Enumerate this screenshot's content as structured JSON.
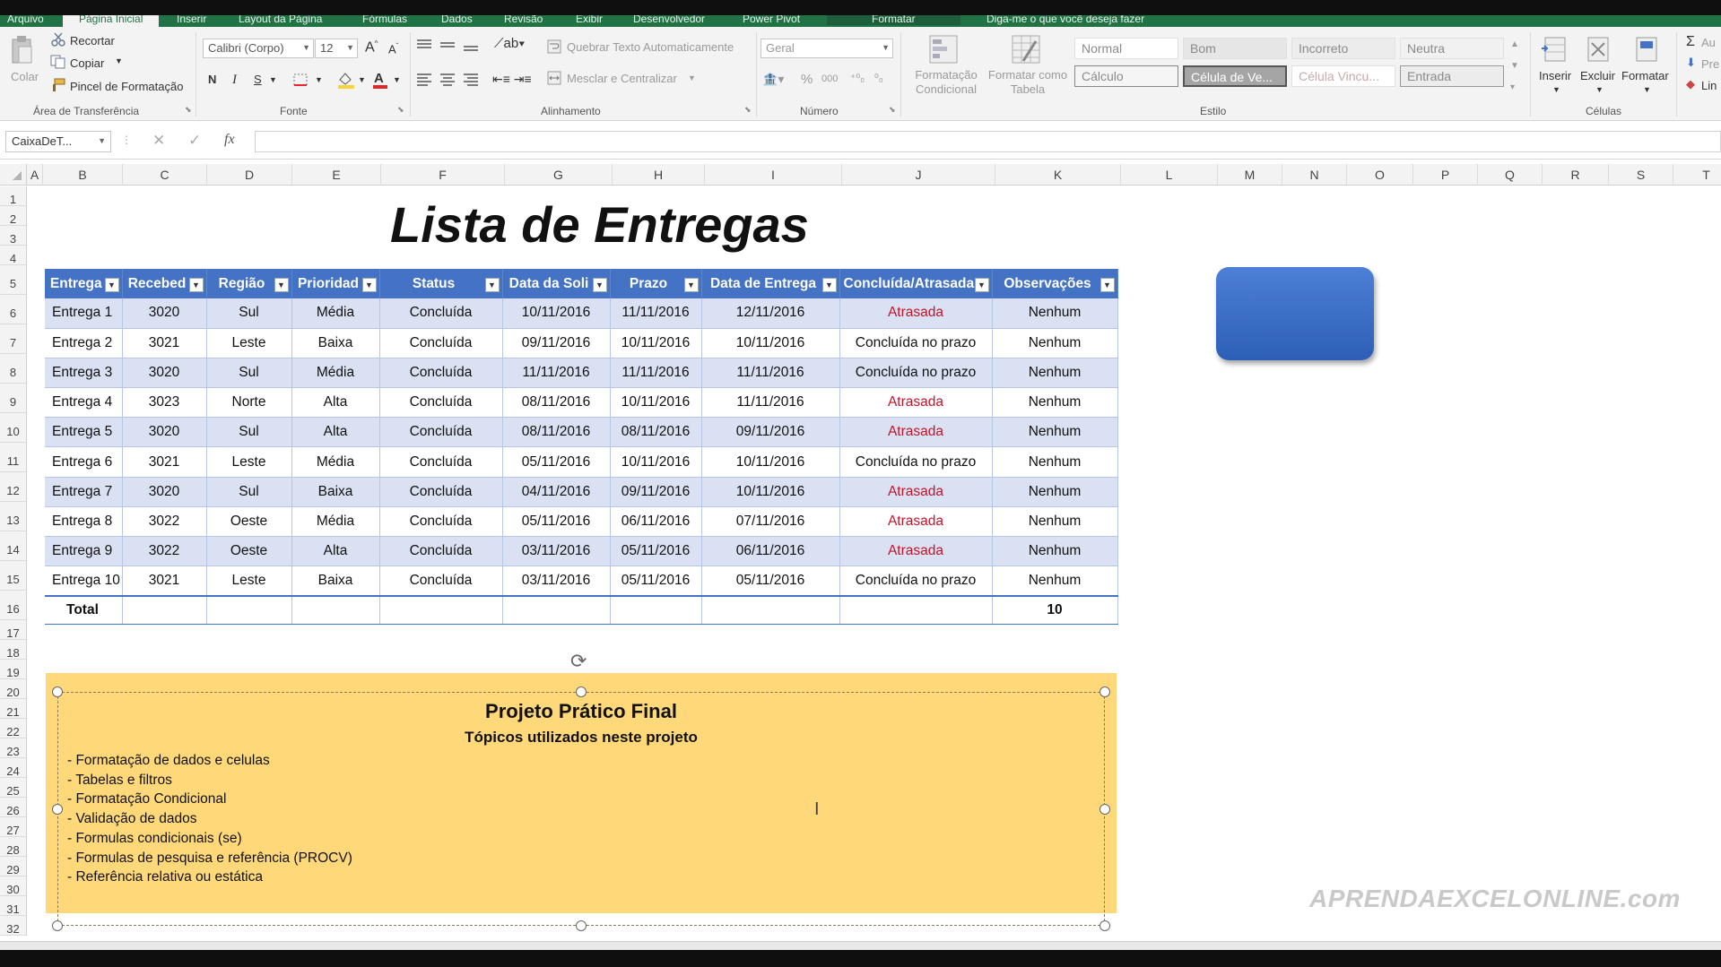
{
  "ribbon_tabs": [
    "Arquivo",
    "Página Inicial",
    "Inserir",
    "Layout da Página",
    "Fórmulas",
    "Dados",
    "Revisão",
    "Exibir",
    "Desenvolvedor",
    "Power Pivot",
    "Formatar",
    "Diga-me o que você deseja fazer"
  ],
  "clipboard": {
    "paste": "Colar",
    "cut": "Recortar",
    "copy": "Copiar",
    "format_painter": "Pincel de Formatação",
    "label": "Área de Transferência"
  },
  "font": {
    "name": "Calibri (Corpo)",
    "size": "12",
    "bold": "N",
    "italic": "I",
    "underline": "S",
    "label": "Fonte"
  },
  "alignment": {
    "wrap": "Quebrar Texto Automaticamente",
    "merge": "Mesclar e Centralizar",
    "label": "Alinhamento"
  },
  "number": {
    "format": "Geral",
    "label": "Número"
  },
  "styles": {
    "conditional": "Formatação Condicional",
    "as_table": "Formatar como Tabela",
    "cells": [
      "Normal",
      "Bom",
      "Incorreto",
      "Neutra",
      "Cálculo",
      "Célula de Ve...",
      "Célula Vincu...",
      "Entrada"
    ],
    "label": "Estilo"
  },
  "cells_group": {
    "insert": "Inserir",
    "delete": "Excluir",
    "format": "Formatar",
    "label": "Células",
    "extra1": "Au",
    "extra2": "Pre",
    "extra3": "Lin"
  },
  "namebox": "CaixaDeT...",
  "fx": "fx",
  "columns": [
    "A",
    "B",
    "C",
    "D",
    "E",
    "F",
    "G",
    "H",
    "I",
    "J",
    "K",
    "L",
    "M",
    "N",
    "O",
    "P",
    "Q",
    "R",
    "S",
    "T"
  ],
  "rows": [
    "1",
    "2",
    "3",
    "4",
    "5",
    "6",
    "7",
    "8",
    "9",
    "10",
    "11",
    "12",
    "13",
    "14",
    "15",
    "16",
    "17",
    "18",
    "19",
    "20",
    "21",
    "22",
    "23",
    "24",
    "25",
    "26",
    "27",
    "28",
    "29",
    "30",
    "31",
    "32"
  ],
  "sheet_title": "Lista de Entregas",
  "table": {
    "headers": [
      "Entrega",
      "Recebed",
      "Região",
      "Prioridad",
      "Status",
      "Data da Soli",
      "Prazo",
      "Data de Entrega",
      "Concluída/Atrasada",
      "Observações"
    ],
    "rows": [
      [
        "Entrega 1",
        "3020",
        "Sul",
        "Média",
        "Concluída",
        "10/11/2016",
        "11/11/2016",
        "12/11/2016",
        "Atrasada",
        "Nenhum"
      ],
      [
        "Entrega 2",
        "3021",
        "Leste",
        "Baixa",
        "Concluída",
        "09/11/2016",
        "10/11/2016",
        "10/11/2016",
        "Concluída no prazo",
        "Nenhum"
      ],
      [
        "Entrega 3",
        "3020",
        "Sul",
        "Média",
        "Concluída",
        "11/11/2016",
        "11/11/2016",
        "11/11/2016",
        "Concluída no prazo",
        "Nenhum"
      ],
      [
        "Entrega 4",
        "3023",
        "Norte",
        "Alta",
        "Concluída",
        "08/11/2016",
        "10/11/2016",
        "11/11/2016",
        "Atrasada",
        "Nenhum"
      ],
      [
        "Entrega 5",
        "3020",
        "Sul",
        "Alta",
        "Concluída",
        "08/11/2016",
        "08/11/2016",
        "09/11/2016",
        "Atrasada",
        "Nenhum"
      ],
      [
        "Entrega 6",
        "3021",
        "Leste",
        "Média",
        "Concluída",
        "05/11/2016",
        "10/11/2016",
        "10/11/2016",
        "Concluída no prazo",
        "Nenhum"
      ],
      [
        "Entrega 7",
        "3020",
        "Sul",
        "Baixa",
        "Concluída",
        "04/11/2016",
        "09/11/2016",
        "10/11/2016",
        "Atrasada",
        "Nenhum"
      ],
      [
        "Entrega 8",
        "3022",
        "Oeste",
        "Média",
        "Concluída",
        "05/11/2016",
        "06/11/2016",
        "07/11/2016",
        "Atrasada",
        "Nenhum"
      ],
      [
        "Entrega 9",
        "3022",
        "Oeste",
        "Alta",
        "Concluída",
        "03/11/2016",
        "05/11/2016",
        "06/11/2016",
        "Atrasada",
        "Nenhum"
      ],
      [
        "Entrega 10",
        "3021",
        "Leste",
        "Baixa",
        "Concluída",
        "03/11/2016",
        "05/11/2016",
        "05/11/2016",
        "Concluída no prazo",
        "Nenhum"
      ]
    ],
    "total_label": "Total",
    "total_value": "10",
    "late_color": "#c0142a",
    "header_color": "#4472c4",
    "band_color": "#d9e1f2"
  },
  "textbox": {
    "title": "Projeto Prático Final",
    "subtitle": "Tópicos utilizados neste projeto",
    "items": [
      "- Formatação de dados e celulas",
      "- Tabelas e filtros",
      "- Formatação Condicional",
      "- Validação de dados",
      "- Formulas condicionais (se)",
      "- Formulas de pesquisa e referência (PROCV)",
      "- Referência relativa ou estática"
    ],
    "fill_color": "#ffd87a"
  },
  "watermark": "APRENDAEXCELONLINE.com",
  "shape_color": "#3a6cc6"
}
